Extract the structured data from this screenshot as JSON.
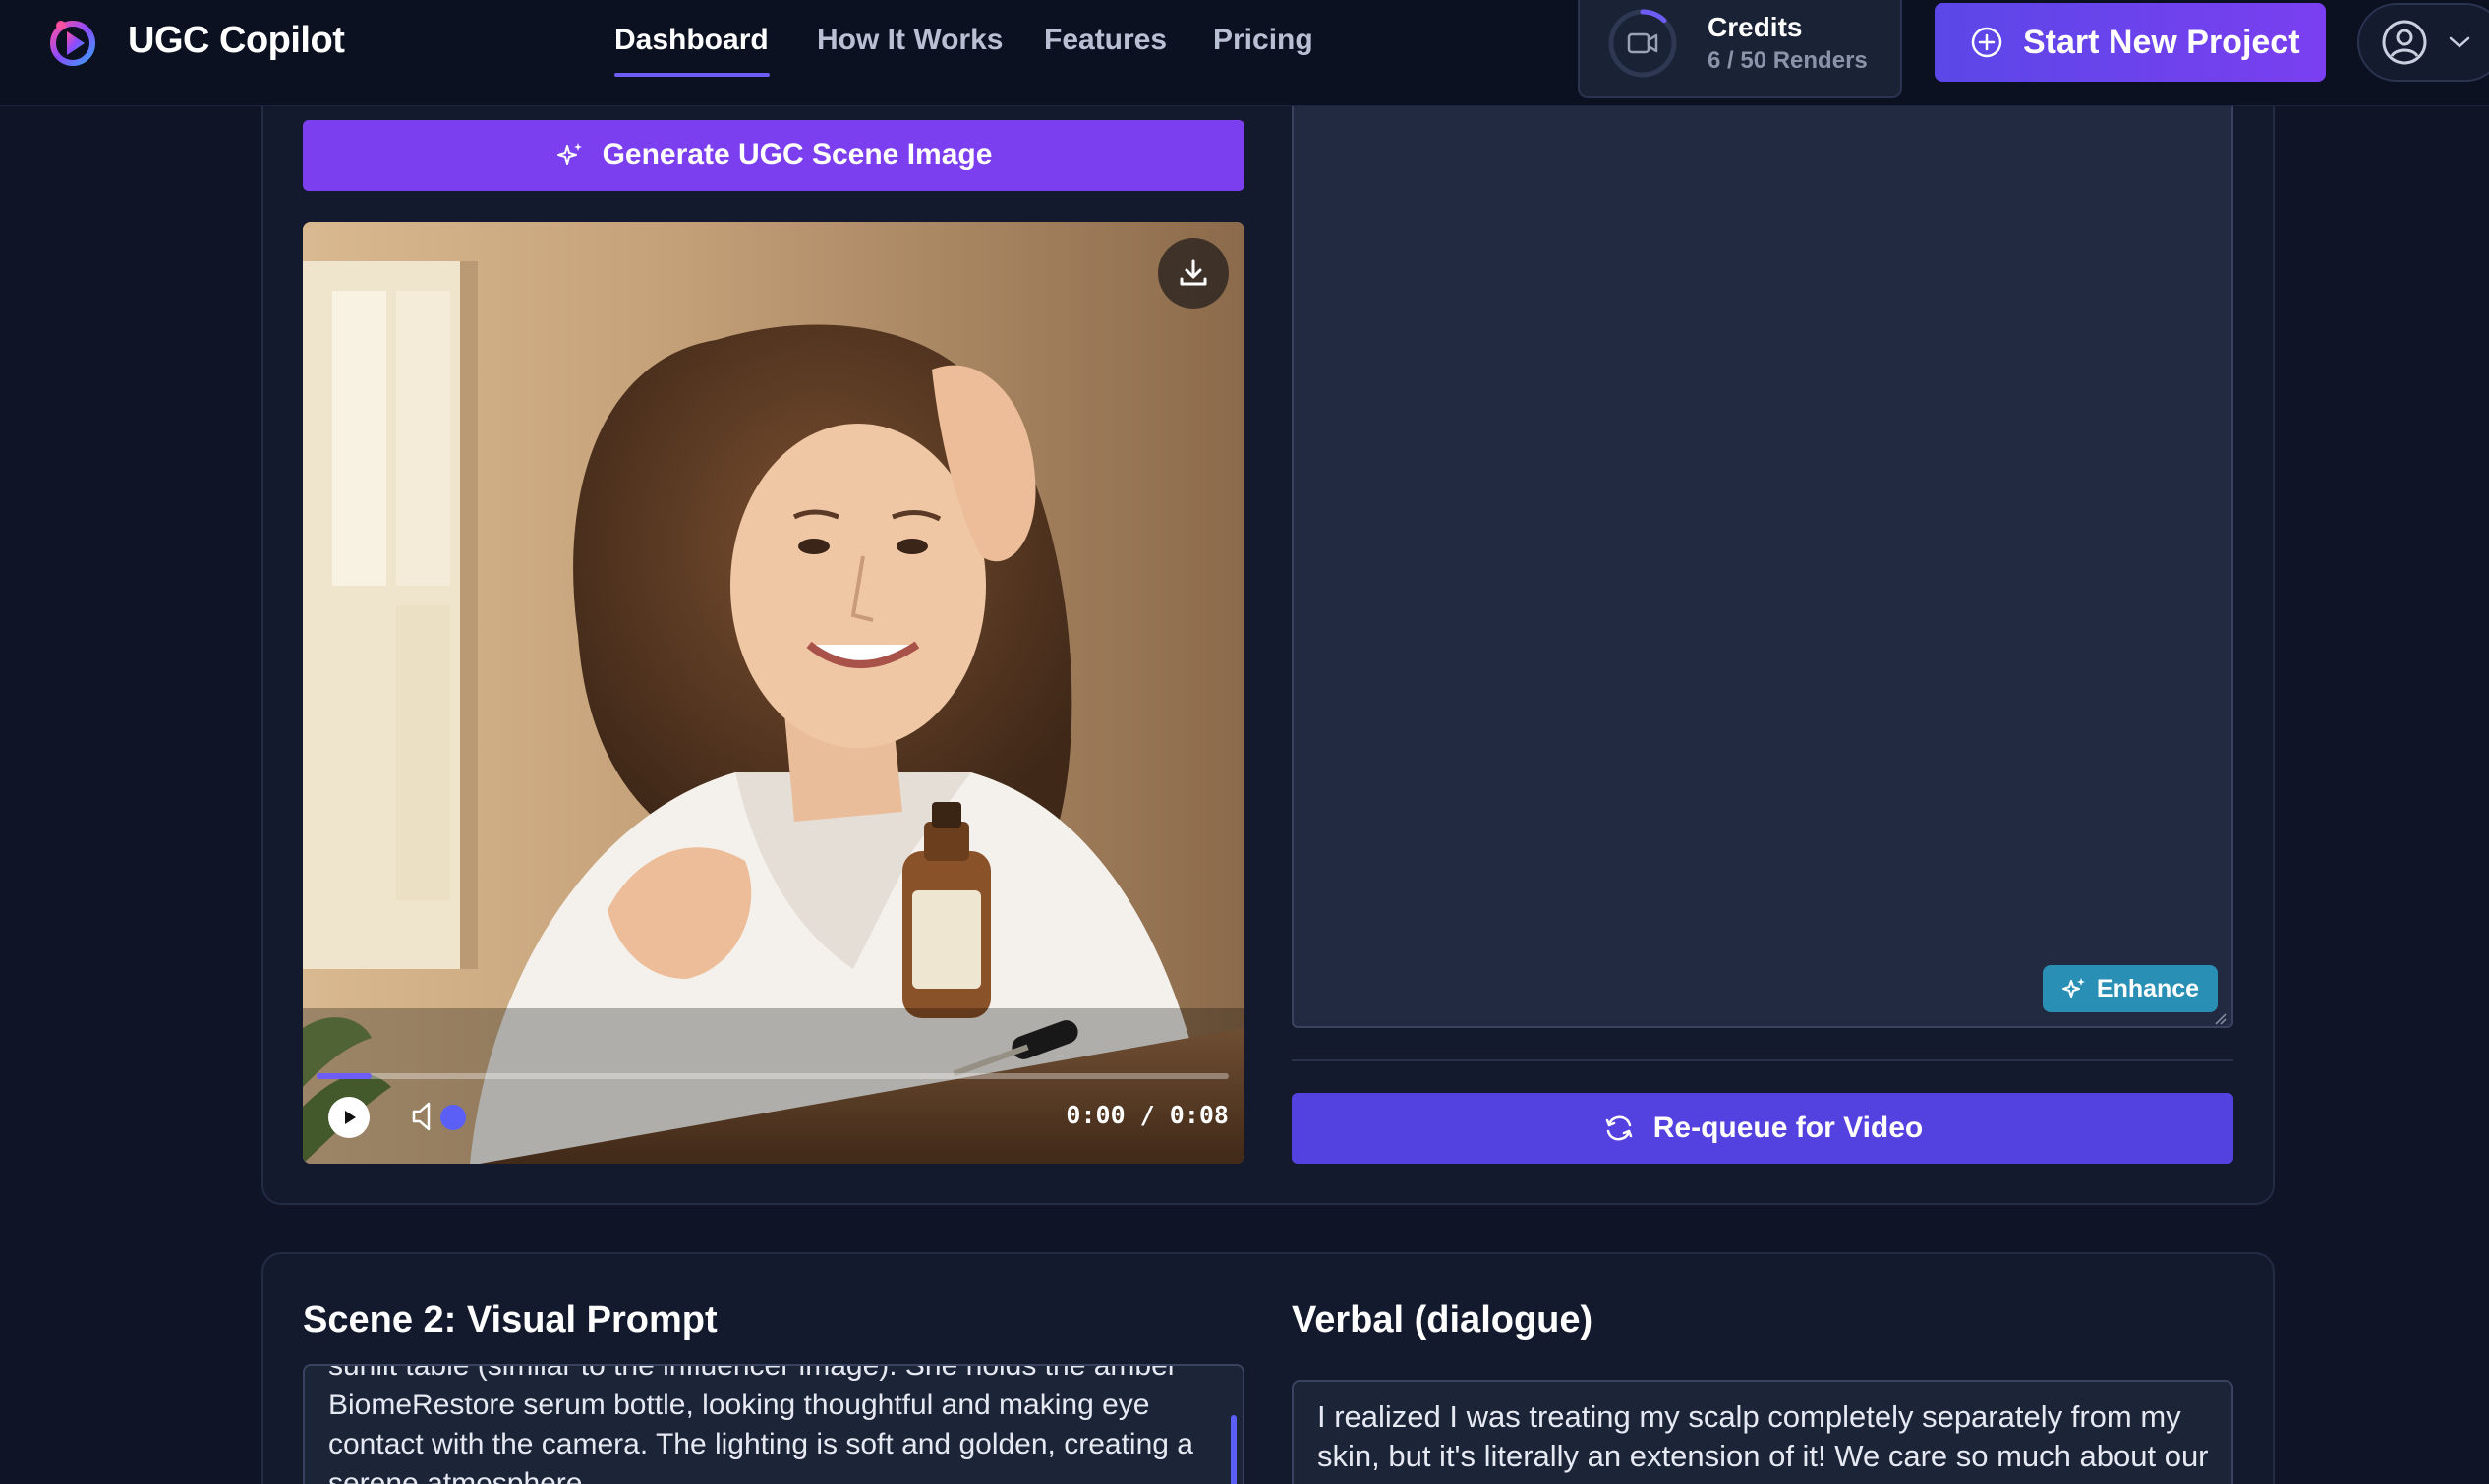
{
  "nav": {
    "brand": "UGC Copilot",
    "links": [
      {
        "label": "Dashboard",
        "active": true
      },
      {
        "label": "How It Works",
        "active": false
      },
      {
        "label": "Features",
        "active": false
      },
      {
        "label": "Pricing",
        "active": false
      }
    ],
    "credits": {
      "title": "Credits",
      "usage": "6 / 50 Renders",
      "used": 6,
      "total": 50
    },
    "start_button": "Start New Project",
    "icons": {
      "logo": "ugc-copilot-logo",
      "credits": "video-camera-icon",
      "start": "plus-circle-icon",
      "user": "user-circle-icon",
      "menu": "chevron-down-icon"
    },
    "accent": "#6d5cf5"
  },
  "scene1": {
    "generate_button": "Generate UGC Scene Image",
    "video": {
      "time": "0:00 / 0:08",
      "progress": 0.06,
      "icons": {
        "download": "download-icon",
        "play": "play-icon",
        "volume": "volume-muted-icon"
      }
    },
    "enhance_button": "Enhance",
    "requeue_button": "Re-queue for Video",
    "colors": {
      "generate": "#7b3ff0",
      "requeue": "#5442e0",
      "enhance": "#2a8fb5"
    }
  },
  "scene2": {
    "title": "Scene 2: Visual Prompt",
    "prompt_text": "sunlit table (similar to the influencer image). She holds the amber BiomeRestore serum bottle, looking thoughtful and making eye contact with the camera. The lighting is soft and golden, creating a serene atmosphere.",
    "verbal_title": "Verbal (dialogue)",
    "verbal_text": "I realized I was treating my scalp completely separately from my skin, but it's literally an extension of it! We care so much about our skin, why not our scalp?"
  }
}
